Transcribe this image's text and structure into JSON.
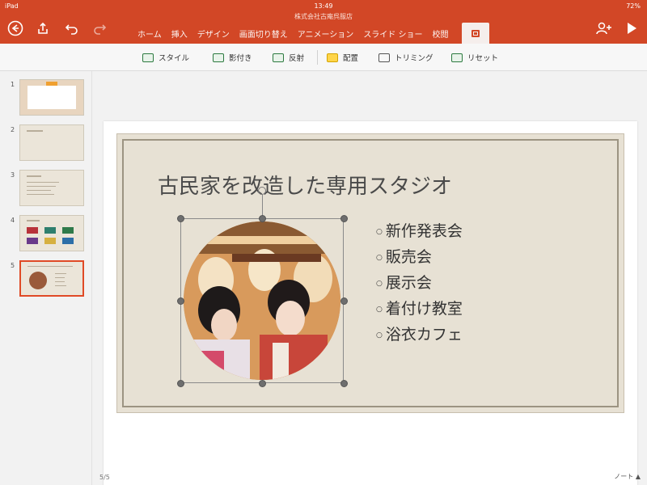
{
  "status": {
    "device": "iPad",
    "time": "13:49",
    "battery": "72%"
  },
  "doc_title": "株式会社古庵呉服店",
  "tabs": [
    {
      "label": "ホーム"
    },
    {
      "label": "挿入"
    },
    {
      "label": "デザイン"
    },
    {
      "label": "画面切り替え"
    },
    {
      "label": "アニメーション"
    },
    {
      "label": "スライド ショー"
    },
    {
      "label": "校閲"
    }
  ],
  "active_tab": "picture",
  "ribbon": {
    "style": "スタイル",
    "shadow": "影付き",
    "reflection": "反射",
    "arrange": "配置",
    "trim": "トリミング",
    "reset": "リセット"
  },
  "thumbnails": [
    {
      "n": "1"
    },
    {
      "n": "2"
    },
    {
      "n": "3"
    },
    {
      "n": "4"
    },
    {
      "n": "5"
    }
  ],
  "slide": {
    "title": "古民家を改造した専用スタジオ",
    "bullets": [
      "新作発表会",
      "販売会",
      "展示会",
      "着付け教室",
      "浴衣カフェ"
    ]
  },
  "footer": {
    "page": "5/5",
    "notes": "ノート"
  },
  "colors": {
    "accent": "#d24726",
    "selection": "#e04a26"
  }
}
